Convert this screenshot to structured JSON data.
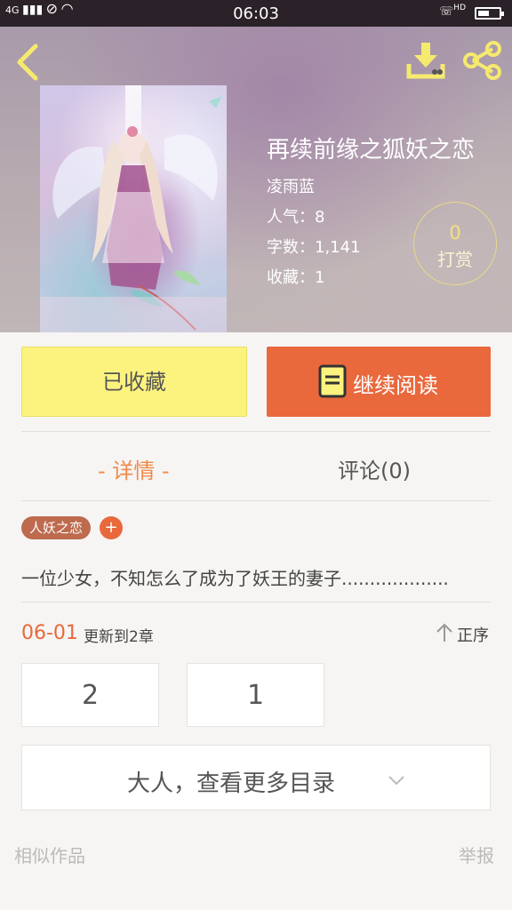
{
  "status_bar": {
    "signal": "4G",
    "time": "06:03",
    "call_badge": "HD"
  },
  "header": {
    "title": "再续前缘之狐妖之恋",
    "author": "凌雨蓝",
    "popularity": "人气：8",
    "word_count": "字数：1,141",
    "favorites": "收藏：1",
    "reward": {
      "count": "0",
      "label": "打赏"
    }
  },
  "actions": {
    "favorited_label": "已收藏",
    "continue_label": "继续阅读"
  },
  "tabs": {
    "detail": "- 详情 -",
    "comments": "评论(0)"
  },
  "tags": {
    "items": [
      "人妖之恋"
    ],
    "add_label": "+"
  },
  "description": "一位少女，不知怎么了成为了妖王的妻子...................",
  "update": {
    "date": "06-01",
    "text": "更新到2章",
    "sort_label": "正序"
  },
  "chapters": [
    "2",
    "1"
  ],
  "more_catalog": "大人，查看更多目录",
  "footer": {
    "similar": "相似作品",
    "report": "举报"
  },
  "colors": {
    "accent_orange": "#e9683c",
    "favorite_yellow": "#fcf37f",
    "reward_gold": "#f2e27c",
    "icon_yellow": "#f6ea6e"
  }
}
